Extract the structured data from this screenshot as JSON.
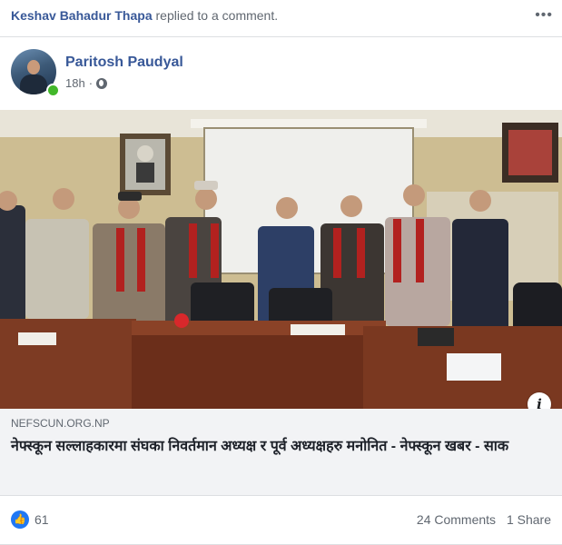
{
  "activity": {
    "actor": "Keshav Bahadur Thapa",
    "action": "replied to a comment."
  },
  "post": {
    "author": "Paritosh Paudyal",
    "time": "18h",
    "privacy_icon": "globe-icon"
  },
  "link": {
    "domain": "NEFSCUN.ORG.NP",
    "headline": "नेफ्स्कून सल्लाहकारमा संघका निवर्तमान अध्यक्ष र पूर्व अध्यक्षहरु मनोनित - नेफ्स्कून खबर - साक"
  },
  "reactions": {
    "likes": "61",
    "comments": "24 Comments",
    "shares": "1 Share"
  },
  "colors": {
    "name_blue": "#385898",
    "like_blue": "#2078f4",
    "online_green": "#42b72a"
  }
}
